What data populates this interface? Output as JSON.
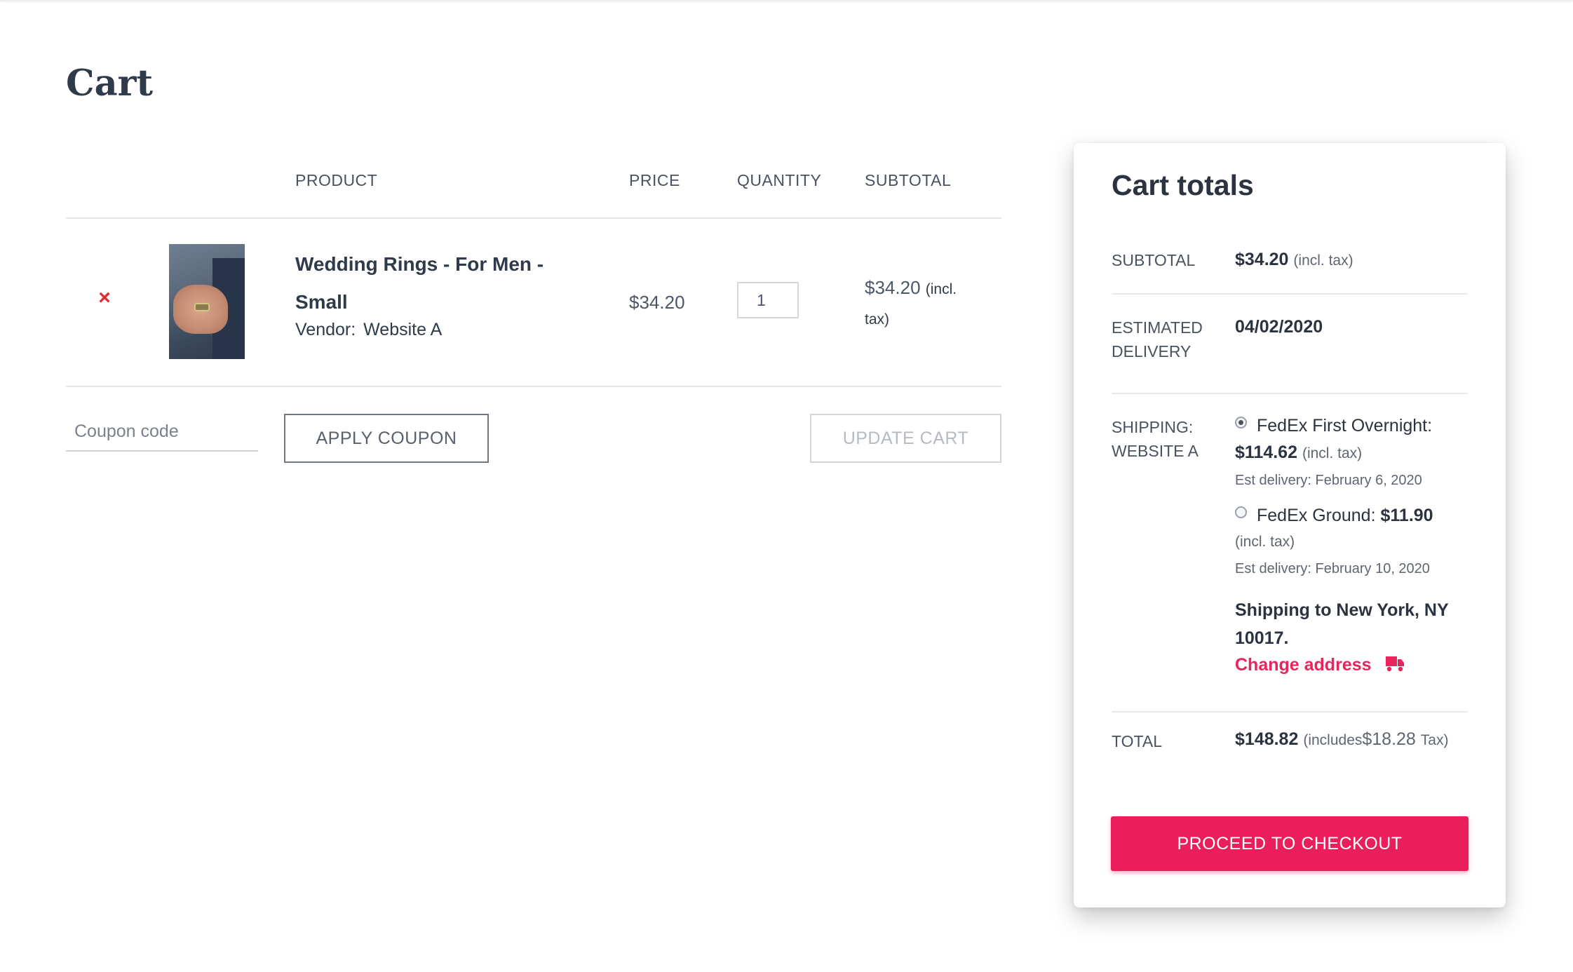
{
  "page": {
    "title": "Cart"
  },
  "cart_table": {
    "headers": {
      "product": "PRODUCT",
      "price": "PRICE",
      "quantity": "QUANTITY",
      "subtotal": "SUBTOTAL"
    },
    "items": [
      {
        "remove": "×",
        "name": "Wedding Rings - For Men - Small",
        "vendor_label": "Vendor:",
        "vendor_name": "Website A",
        "price": "$34.20",
        "quantity": "1",
        "subtotal": "$34.20",
        "subtotal_note": "(incl. tax)"
      }
    ]
  },
  "actions": {
    "coupon_placeholder": "Coupon code",
    "apply_coupon": "APPLY COUPON",
    "update_cart": "UPDATE CART"
  },
  "totals": {
    "title": "Cart totals",
    "subtotal_label": "SUBTOTAL",
    "subtotal_value": "$34.20",
    "subtotal_note": "(incl. tax)",
    "delivery_label": "ESTIMATED DELIVERY",
    "delivery_value": "04/02/2020",
    "shipping_label": "SHIPPING: WEBSITE A",
    "shipping_options": [
      {
        "name": "FedEx First Overnight:",
        "price": "$114.62",
        "note": "(incl. tax)",
        "est": "Est delivery: February 6, 2020",
        "selected": true
      },
      {
        "name": "FedEx Ground:",
        "price": "$11.90",
        "note": "(incl. tax)",
        "est": "Est delivery: February 10, 2020",
        "selected": false
      }
    ],
    "shipping_to": "Shipping to New York, NY 10017.",
    "change_address": "Change address",
    "change_address_icon": "truck-icon",
    "total_label": "TOTAL",
    "total_value": "$148.82",
    "total_note_prefix": "(includes",
    "total_tax": "$18.28",
    "total_note_suffix": "Tax)",
    "checkout": "PROCEED TO CHECKOUT"
  },
  "colors": {
    "accent": "#e91e5a",
    "remove": "#e32a2a",
    "text": "#2c3340"
  }
}
